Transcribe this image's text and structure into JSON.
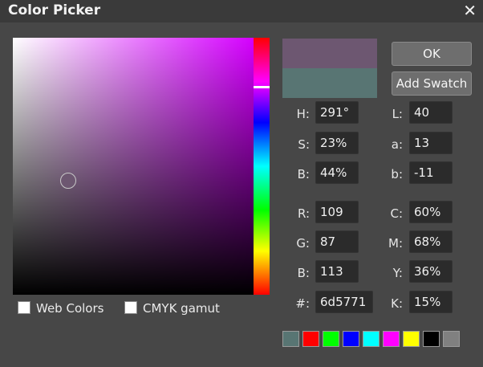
{
  "window": {
    "title": "Color Picker",
    "close_icon": "close-icon"
  },
  "current_color": "#6d5771",
  "previous_color": "#587573",
  "hue_position_fraction": 0.19,
  "buttons": {
    "ok": "OK",
    "add_swatch": "Add Swatch"
  },
  "hsb": {
    "h_label": "H:",
    "h_value": "291°",
    "s_label": "S:",
    "s_value": "23%",
    "b_label": "B:",
    "b_value": "44%"
  },
  "lab": {
    "l_label": "L:",
    "l_value": "40",
    "a_label": "a:",
    "a_value": "13",
    "b_label": "b:",
    "b_value": "-11"
  },
  "rgb": {
    "r_label": "R:",
    "r_value": "109",
    "g_label": "G:",
    "g_value": "87",
    "b_label": "B:",
    "b_value": "113"
  },
  "cmyk": {
    "c_label": "C:",
    "c_value": "60%",
    "m_label": "M:",
    "m_value": "68%",
    "y_label": "Y:",
    "y_value": "36%",
    "k_label": "K:",
    "k_value": "15%"
  },
  "hex": {
    "label": "#:",
    "value": "6d5771"
  },
  "options": {
    "web_colors": "Web Colors",
    "cmyk_gamut": "CMYK gamut"
  },
  "swatches": [
    "#587573",
    "#ff0000",
    "#00ff00",
    "#0000ff",
    "#00ffff",
    "#ff00ff",
    "#ffff00",
    "#000000",
    "#808080"
  ]
}
